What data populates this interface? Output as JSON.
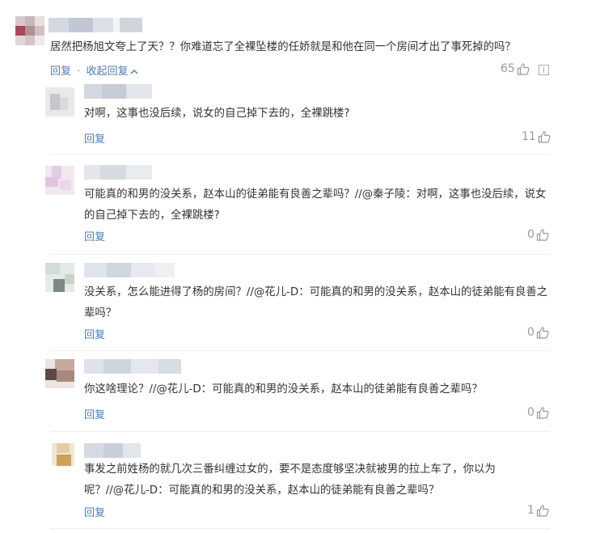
{
  "main_comment": {
    "text": "居然把杨旭文夸上了天？？你难道忘了全裸坠楼的任娇就是和他在同一个房间才出了事死掉的吗？",
    "reply_label": "回复",
    "separator": "·",
    "collapse_label": "收起回复",
    "likes": "65"
  },
  "replies": [
    {
      "text": "对啊，这事也没后续，说女的自己掉下去的，全裸跳楼?",
      "reply_label": "回复",
      "likes": "11"
    },
    {
      "text": "可能真的和男的没关系，赵本山的徒弟能有良善之辈吗？//@秦子陵：对啊，这事也没后续，说女的自己掉下去的，全裸跳楼?",
      "reply_label": "回复",
      "likes": "0"
    },
    {
      "text": "没关系，怎么能进得了杨的房间？//@花儿-D：可能真的和男的没关系，赵本山的徒弟能有良善之辈吗？",
      "reply_label": "回复",
      "likes": "0"
    },
    {
      "text": "你这啥理论？//@花儿-D：可能真的和男的没关系，赵本山的徒弟能有良善之辈吗？",
      "reply_label": "回复",
      "likes": "0"
    },
    {
      "text": "事发之前姓杨的就几次三番纠缠过女的，要不是态度够坚决就被男的拉上车了，你以为呢？//@花儿-D：可能真的和男的没关系，赵本山的徒弟能有良善之辈吗？",
      "reply_label": "回复",
      "likes": "1"
    }
  ],
  "icons": {
    "like": "thumbs-up-icon",
    "report": "report-icon",
    "collapse": "chevron-up-icon"
  },
  "colors": {
    "link": "#507daf",
    "text": "#333333",
    "muted": "#999999",
    "divider": "#eeeeee"
  }
}
